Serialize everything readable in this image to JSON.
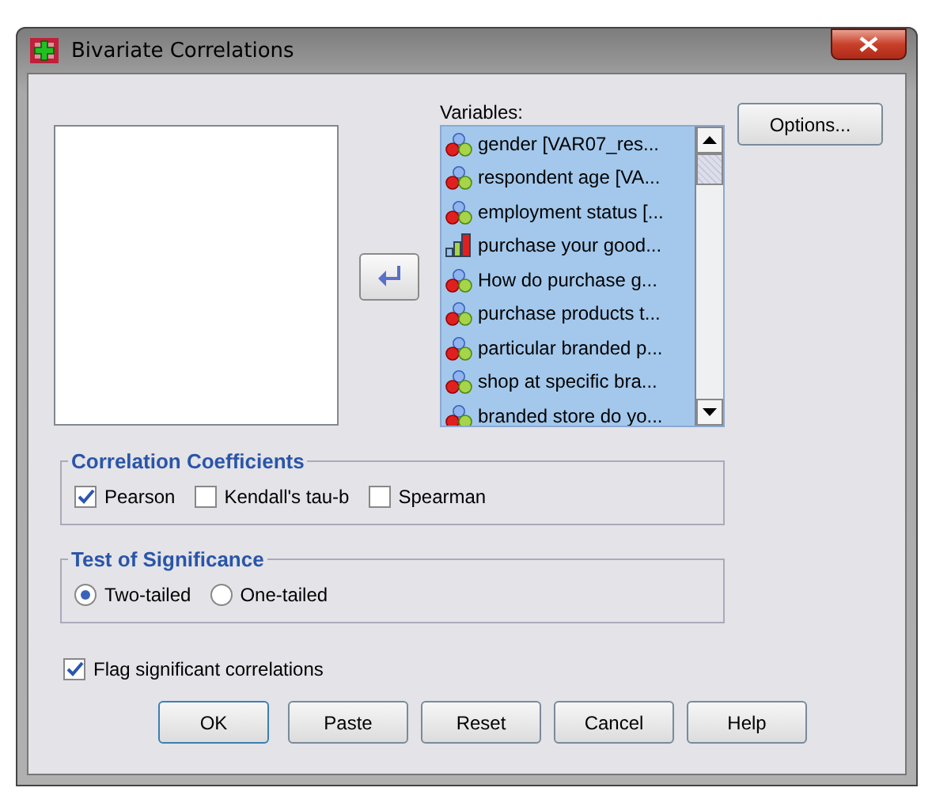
{
  "window": {
    "title": "Bivariate Correlations"
  },
  "variables": {
    "label": "Variables:",
    "items": [
      {
        "name": "gender [VAR07_res...",
        "kind": "nominal",
        "selected": true
      },
      {
        "name": "respondent age [VA...",
        "kind": "nominal",
        "selected": true
      },
      {
        "name": "employment status [...",
        "kind": "nominal",
        "selected": true
      },
      {
        "name": "purchase your good...",
        "kind": "ordinal",
        "selected": true
      },
      {
        "name": "How do purchase g...",
        "kind": "nominal",
        "selected": true
      },
      {
        "name": "purchase products t...",
        "kind": "nominal",
        "selected": true
      },
      {
        "name": "particular branded p...",
        "kind": "nominal",
        "selected": true
      },
      {
        "name": "shop at specific bra...",
        "kind": "nominal",
        "selected": true
      },
      {
        "name": "branded store do yo...",
        "kind": "nominal",
        "selected": true
      }
    ]
  },
  "options_button": "Options...",
  "correlation_coefficients": {
    "title": "Correlation Coefficients",
    "options": [
      {
        "label": "Pearson",
        "checked": true
      },
      {
        "label": "Kendall's tau-b",
        "checked": false
      },
      {
        "label": "Spearman",
        "checked": false
      }
    ]
  },
  "test_of_significance": {
    "title": "Test of Significance",
    "options": [
      {
        "label": "Two-tailed",
        "selected": true
      },
      {
        "label": "One-tailed",
        "selected": false
      }
    ]
  },
  "flag_significant": {
    "label": "Flag significant correlations",
    "checked": true
  },
  "buttons": [
    "OK",
    "Paste",
    "Reset",
    "Cancel",
    "Help"
  ]
}
